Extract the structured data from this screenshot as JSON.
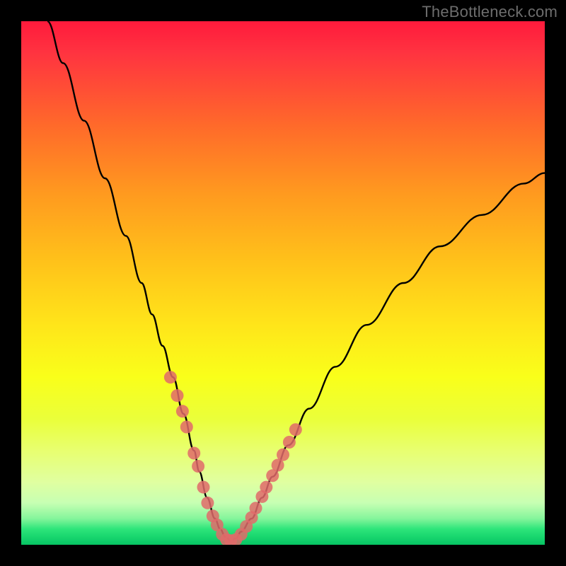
{
  "watermark": "TheBottleneck.com",
  "chart_data": {
    "type": "line",
    "title": "",
    "xlabel": "",
    "ylabel": "",
    "xlim": [
      0,
      100
    ],
    "ylim": [
      0,
      100
    ],
    "series": [
      {
        "name": "main-curve",
        "color": "#000000",
        "x": [
          5,
          8,
          12,
          16,
          20,
          23,
          25,
          27,
          29,
          31,
          33,
          34,
          35.5,
          37,
          38,
          39,
          40,
          41,
          42,
          44,
          46,
          48,
          51,
          55,
          60,
          66,
          73,
          80,
          88,
          96,
          100
        ],
        "y": [
          100,
          92,
          81,
          70,
          59,
          50,
          44,
          38,
          32,
          25,
          18,
          14,
          9,
          5,
          3,
          1.5,
          0.8,
          1.2,
          2.5,
          5,
          9,
          13,
          19,
          26,
          34,
          42,
          50,
          57,
          63,
          69,
          71
        ]
      },
      {
        "name": "highlight-dots",
        "color": "#e06a6a",
        "x": [
          28.5,
          29.8,
          30.8,
          31.6,
          33.0,
          33.8,
          34.8,
          35.6,
          36.6,
          37.4,
          38.4,
          39.2,
          40.0,
          41.0,
          42.0,
          43.0,
          44.0,
          44.8,
          46.0,
          46.8,
          48.0,
          49.0,
          50.0,
          51.2,
          52.4
        ],
        "y": [
          32.0,
          28.5,
          25.5,
          22.5,
          17.5,
          15.0,
          11.0,
          8.0,
          5.5,
          3.8,
          2.0,
          1.0,
          0.8,
          1.0,
          2.0,
          3.5,
          5.2,
          7.0,
          9.2,
          11.0,
          13.2,
          15.2,
          17.2,
          19.6,
          22.0
        ]
      }
    ]
  }
}
